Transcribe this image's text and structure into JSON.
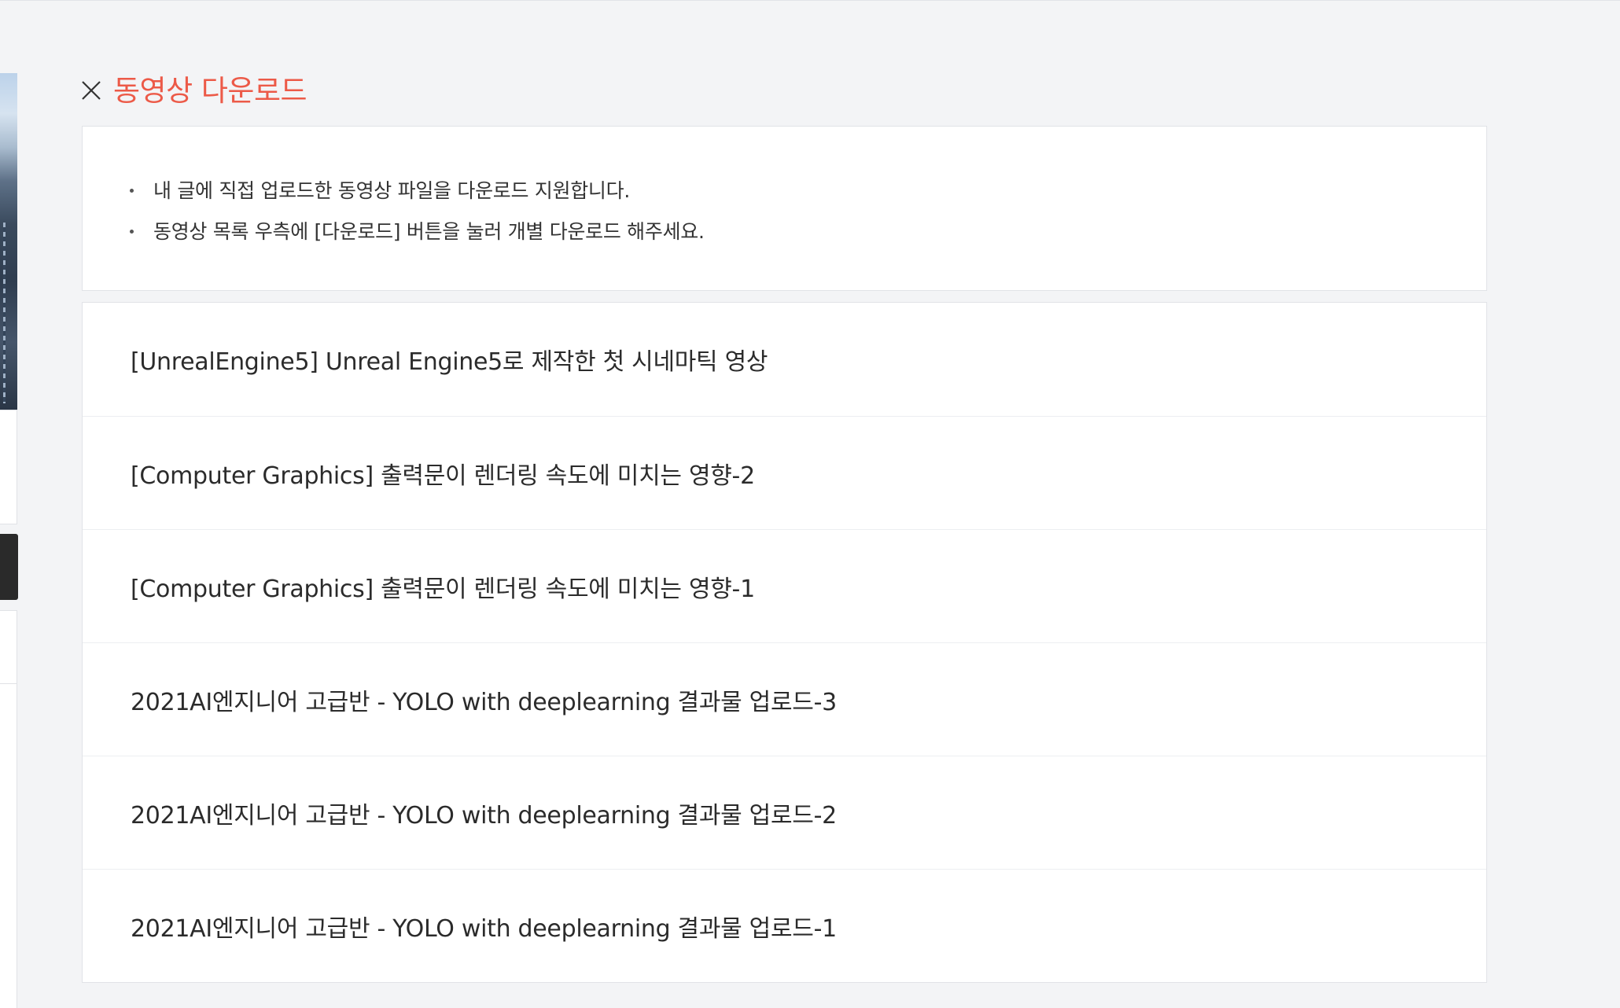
{
  "panel": {
    "title": "동영상 다운로드",
    "close_icon": "close-icon",
    "title_color": "#ec5a48"
  },
  "notice": {
    "items": [
      "내 글에 직접 업로드한 동영상 파일을 다운로드 지원합니다.",
      "동영상 목록 우측에 [다운로드] 버튼을 눌러 개별 다운로드 해주세요."
    ]
  },
  "videos": [
    {
      "title": "[UnrealEngine5] Unreal Engine5로 제작한 첫 시네마틱 영상"
    },
    {
      "title": "[Computer Graphics] 출력문이 렌더링 속도에 미치는 영향-2"
    },
    {
      "title": "[Computer Graphics] 출력문이 렌더링 속도에 미치는 영향-1"
    },
    {
      "title": "2021AI엔지니어 고급반 - YOLO with deeplearning 결과물 업로드-3"
    },
    {
      "title": "2021AI엔지니어 고급반 - YOLO with deeplearning 결과물 업로드-2"
    },
    {
      "title": "2021AI엔지니어 고급반 - YOLO with deeplearning 결과물 업로드-1"
    }
  ]
}
